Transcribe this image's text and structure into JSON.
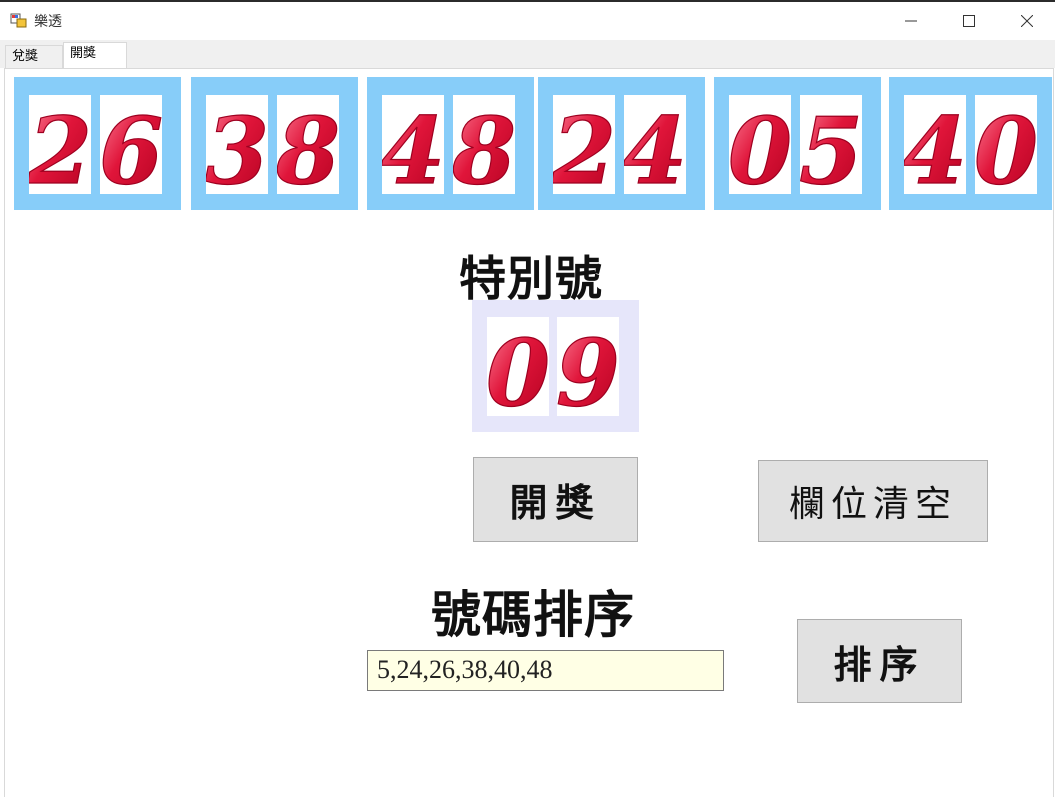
{
  "window": {
    "title": "樂透"
  },
  "tabs": [
    {
      "label": "兌獎"
    },
    {
      "label": "開獎"
    }
  ],
  "winning_numbers": [
    {
      "tens": "2",
      "ones": "6"
    },
    {
      "tens": "3",
      "ones": "8"
    },
    {
      "tens": "4",
      "ones": "8"
    },
    {
      "tens": "2",
      "ones": "4"
    },
    {
      "tens": "0",
      "ones": "5"
    },
    {
      "tens": "4",
      "ones": "0"
    }
  ],
  "special": {
    "label": "特別號",
    "tens": "0",
    "ones": "9"
  },
  "buttons": {
    "draw": "開獎",
    "clear": "欄位清空",
    "sort": "排序"
  },
  "sort_section": {
    "label": "號碼排序",
    "result": "5,24,26,38,40,48"
  },
  "colors": {
    "panel": "#87cdf9",
    "special_panel": "#e6e6fa",
    "digit": "#e0153a",
    "result_bg": "#ffffe5"
  }
}
